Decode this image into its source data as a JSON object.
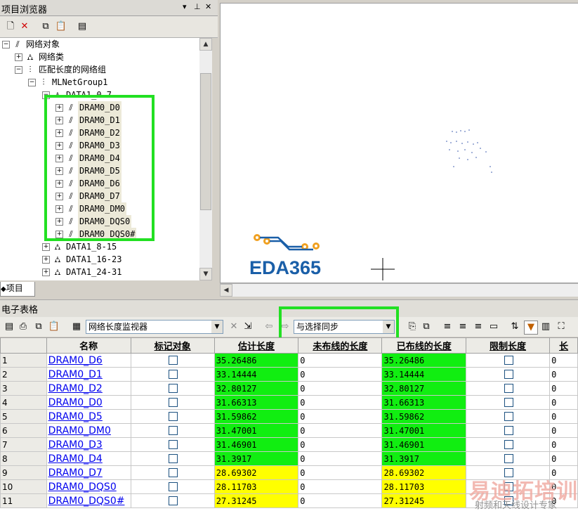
{
  "browser": {
    "title": "项目浏览器",
    "tab_label": "项目",
    "tree": [
      {
        "label": "网络对象",
        "icon": "net-icon"
      },
      {
        "label": "网络类",
        "icon": "netclass-icon"
      },
      {
        "label": "匹配长度的网络组",
        "icon": "matchgroup-icon"
      },
      {
        "label": "MLNetGroup1",
        "icon": "matchgroup-icon"
      },
      {
        "label": "DATA1_0-7",
        "icon": "netclass-icon"
      },
      {
        "label": "DRAM0_D0",
        "icon": "net-icon"
      },
      {
        "label": "DRAM0_D1",
        "icon": "net-icon"
      },
      {
        "label": "DRAM0_D2",
        "icon": "net-icon"
      },
      {
        "label": "DRAM0_D3",
        "icon": "net-icon"
      },
      {
        "label": "DRAM0_D4",
        "icon": "net-icon"
      },
      {
        "label": "DRAM0_D5",
        "icon": "net-icon"
      },
      {
        "label": "DRAM0_D6",
        "icon": "net-icon"
      },
      {
        "label": "DRAM0_D7",
        "icon": "net-icon"
      },
      {
        "label": "DRAM0_DM0",
        "icon": "net-icon"
      },
      {
        "label": "DRAM0_DQS0",
        "icon": "net-icon"
      },
      {
        "label": "DRAM0_DQS0#",
        "icon": "net-icon"
      },
      {
        "label": "DATA1_8-15",
        "icon": "netclass-icon"
      },
      {
        "label": "DATA1_16-23",
        "icon": "netclass-icon"
      },
      {
        "label": "DATA1_24-31",
        "icon": "netclass-icon"
      }
    ]
  },
  "canvas": {
    "logo_text": "EDA365"
  },
  "sheet": {
    "title": "电子表格",
    "monitor_select": "网络长度监视器",
    "sync_select": "与选择同步",
    "columns": [
      "名称",
      "标记对象",
      "估计长度",
      "未布线的长度",
      "已布线的长度",
      "限制长度",
      "长"
    ],
    "rows": [
      {
        "n": "1",
        "name": "DRAM0_D6",
        "est": "35.26486",
        "unrouted": "0",
        "routed": "35.26486",
        "limit": "0",
        "color": "g"
      },
      {
        "n": "2",
        "name": "DRAM0_D1",
        "est": "33.14444",
        "unrouted": "0",
        "routed": "33.14444",
        "limit": "0",
        "color": "g"
      },
      {
        "n": "3",
        "name": "DRAM0_D2",
        "est": "32.80127",
        "unrouted": "0",
        "routed": "32.80127",
        "limit": "0",
        "color": "g"
      },
      {
        "n": "4",
        "name": "DRAM0_D0",
        "est": "31.66313",
        "unrouted": "0",
        "routed": "31.66313",
        "limit": "0",
        "color": "g"
      },
      {
        "n": "5",
        "name": "DRAM0_D5",
        "est": "31.59862",
        "unrouted": "0",
        "routed": "31.59862",
        "limit": "0",
        "color": "g"
      },
      {
        "n": "6",
        "name": "DRAM0_DM0",
        "est": "31.47001",
        "unrouted": "0",
        "routed": "31.47001",
        "limit": "0",
        "color": "g"
      },
      {
        "n": "7",
        "name": "DRAM0_D3",
        "est": "31.46901",
        "unrouted": "0",
        "routed": "31.46901",
        "limit": "0",
        "color": "g"
      },
      {
        "n": "8",
        "name": "DRAM0_D4",
        "est": "31.3917",
        "unrouted": "0",
        "routed": "31.3917",
        "limit": "0",
        "color": "g"
      },
      {
        "n": "9",
        "name": "DRAM0_D7",
        "est": "28.69302",
        "unrouted": "0",
        "routed": "28.69302",
        "limit": "0",
        "color": "y"
      },
      {
        "n": "10",
        "name": "DRAM0_DQS0",
        "est": "28.11703",
        "unrouted": "0",
        "routed": "28.11703",
        "limit": "0",
        "color": "y"
      },
      {
        "n": "11",
        "name": "DRAM0_DQS0#",
        "est": "27.31245",
        "unrouted": "0",
        "routed": "27.31245",
        "limit": "0",
        "color": "y"
      }
    ]
  },
  "watermark": {
    "brand": "易迪拓培训",
    "tagline": "射频和天线设计专家"
  }
}
